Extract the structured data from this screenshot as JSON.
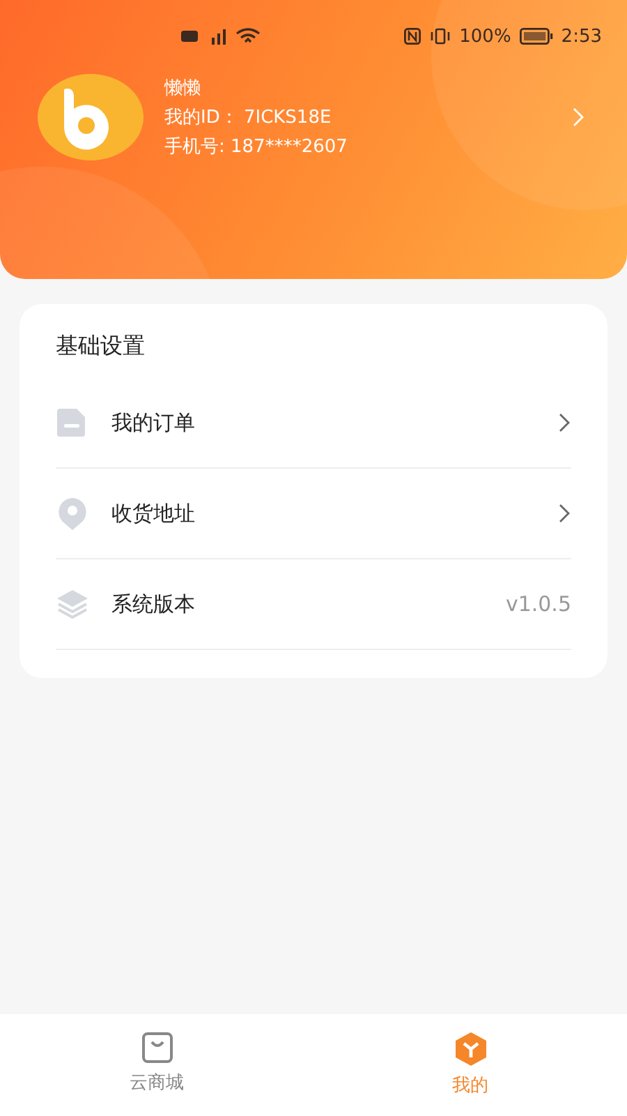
{
  "status_bar": {
    "battery": "100%",
    "time": "2:53"
  },
  "profile": {
    "nickname": "懒懒",
    "user_id": "我的ID：  7ICKS18E",
    "phone": "手机号: 187****2607"
  },
  "settings": {
    "title": "基础设置",
    "rows": [
      {
        "kind": "link",
        "label": "我的订单"
      },
      {
        "kind": "link",
        "label": "收货地址"
      },
      {
        "kind": "value",
        "label": "系统版本",
        "value": "v1.0.5"
      }
    ]
  },
  "tabs": [
    {
      "label": "云商城",
      "selected": false
    },
    {
      "label": "我的",
      "selected": true
    }
  ]
}
